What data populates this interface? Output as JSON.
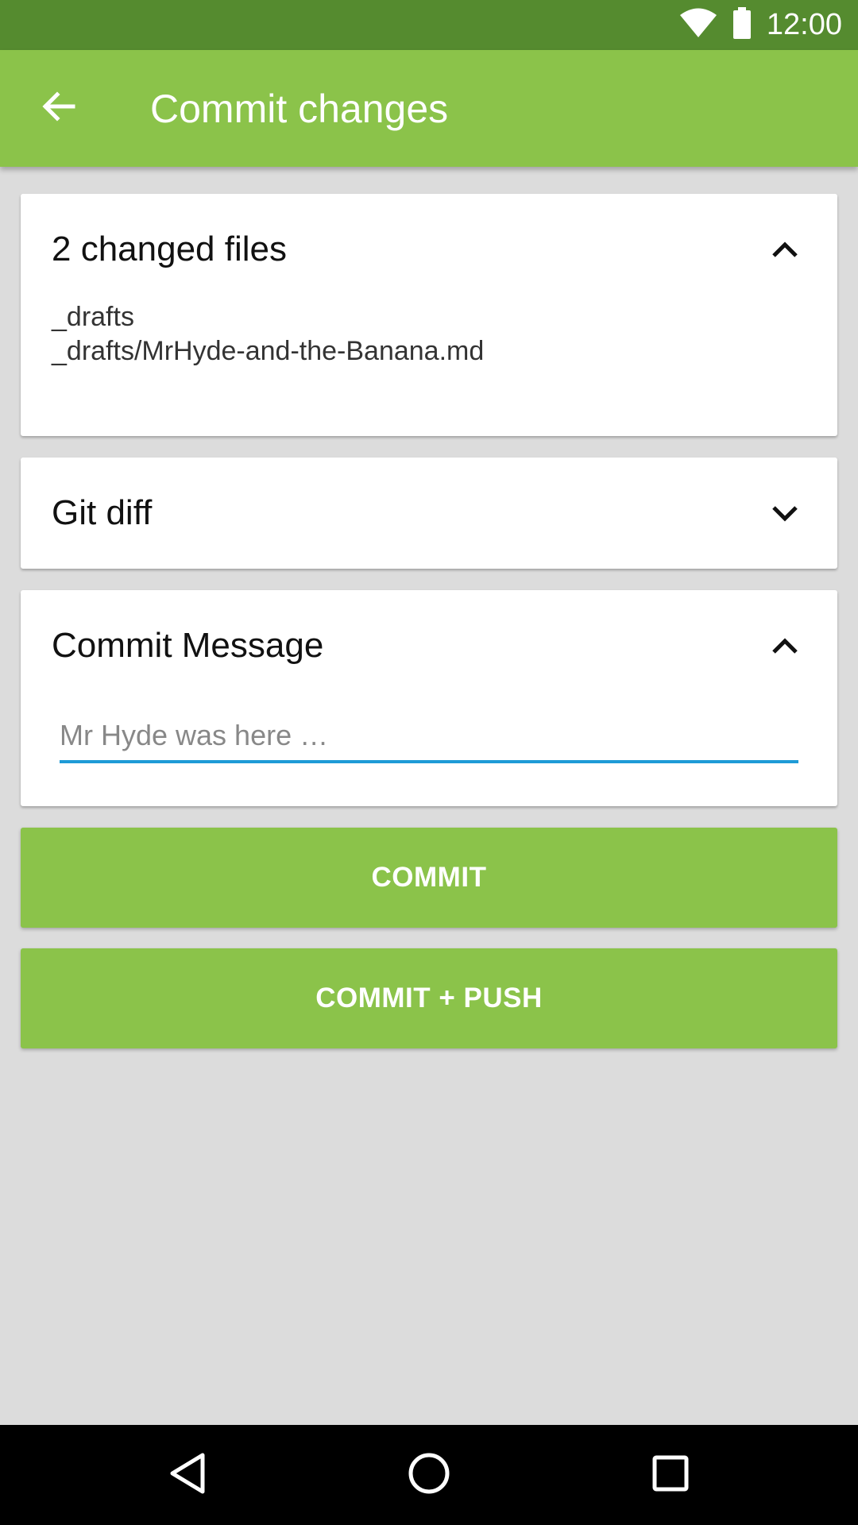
{
  "status_bar": {
    "time": "12:00",
    "icons": [
      "wifi-icon",
      "battery-icon"
    ]
  },
  "app_bar": {
    "title": "Commit changes",
    "back_icon": "arrow-back-icon"
  },
  "changed_files": {
    "title": "2 changed files",
    "expanded": true,
    "files": [
      "_drafts",
      "_drafts/MrHyde-and-the-Banana.md"
    ]
  },
  "git_diff": {
    "title": "Git diff",
    "expanded": false
  },
  "commit_message": {
    "title": "Commit Message",
    "expanded": true,
    "value": "",
    "placeholder": "Mr Hyde was here …"
  },
  "buttons": {
    "commit": "COMMIT",
    "commit_push": "COMMIT + PUSH"
  },
  "nav_bar": {
    "icons": [
      "back-triangle-icon",
      "home-circle-icon",
      "recents-square-icon"
    ]
  },
  "colors": {
    "primary": "#8bc34a",
    "primary_dark": "#558b2f",
    "accent": "#1e9bd7",
    "background": "#dcdcdc"
  }
}
